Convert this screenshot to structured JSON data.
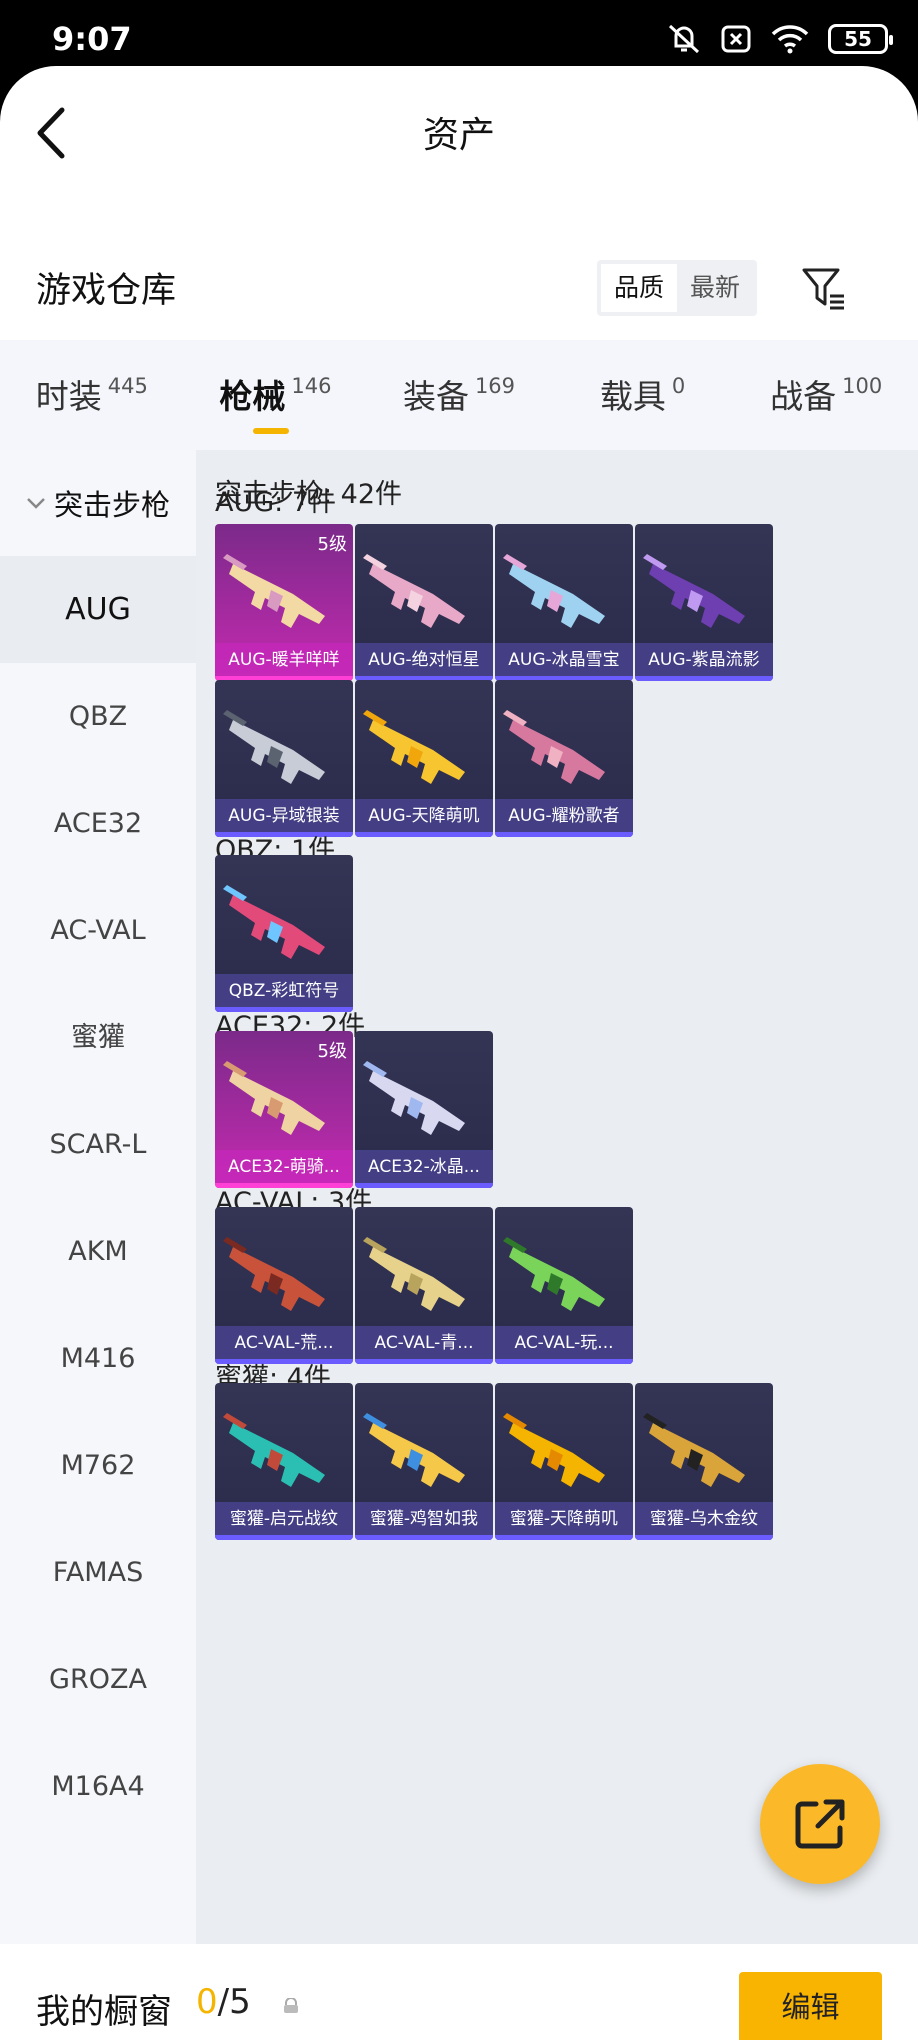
{
  "status": {
    "time": "9:07",
    "battery": "55"
  },
  "header": {
    "title": "资产"
  },
  "warehouse": {
    "title": "游戏仓库",
    "sort_quality": "品质",
    "sort_newest": "最新"
  },
  "categories": [
    {
      "name": "时装",
      "count": "445"
    },
    {
      "name": "枪械",
      "count": "146"
    },
    {
      "name": "装备",
      "count": "169"
    },
    {
      "name": "载具",
      "count": "0"
    },
    {
      "name": "战备",
      "count": "100"
    }
  ],
  "sidebar": {
    "group": "突击步枪",
    "items": [
      "AUG",
      "QBZ",
      "ACE32",
      "AC-VAL",
      "蜜獾",
      "SCAR-L",
      "AKM",
      "M416",
      "M762",
      "FAMAS",
      "GROZA",
      "M16A4"
    ]
  },
  "content": {
    "total": "突击步枪: 42件",
    "groups": [
      {
        "label": "AUG: 7件",
        "items": [
          "AUG-暖羊咩咩",
          "AUG-绝对恒星",
          "AUG-冰晶雪宝",
          "AUG-紫晶流影",
          "AUG-异域银装",
          "AUG-天降萌叽",
          "AUG-耀粉歌者"
        ]
      },
      {
        "label": "QBZ: 1件",
        "items": [
          "QBZ-彩虹符号"
        ]
      },
      {
        "label": "ACE32: 2件",
        "items": [
          "ACE32-萌骑...",
          "ACE32-冰晶..."
        ]
      },
      {
        "label": "AC-VAL: 3件",
        "items": [
          "AC-VAL-荒...",
          "AC-VAL-青...",
          "AC-VAL-玩..."
        ]
      },
      {
        "label": "蜜獾: 4件",
        "items": [
          "蜜獾-启元战纹",
          "蜜獾-鸡智如我",
          "蜜獾-天降萌叽",
          "蜜獾-乌木金纹"
        ]
      }
    ],
    "level_badge": "5级"
  },
  "bottom": {
    "showcase_label": "我的橱窗",
    "count_current": "0",
    "count_rest": "/5",
    "edit_label": "编辑"
  }
}
